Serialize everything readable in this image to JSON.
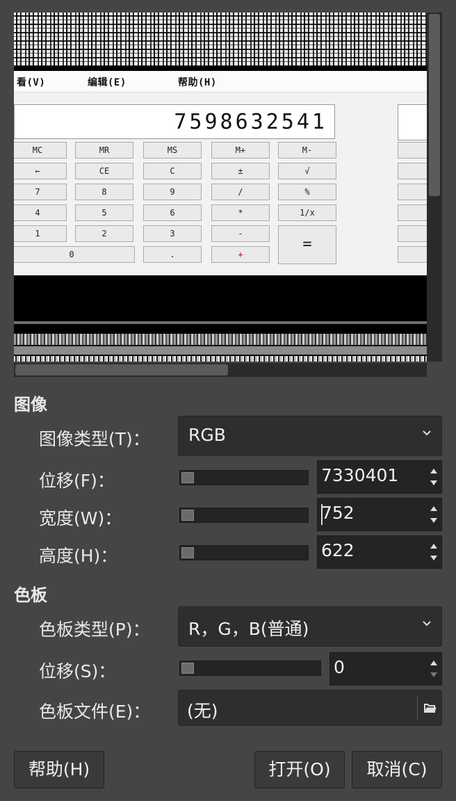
{
  "preview": {
    "menu": [
      "看(V)",
      "编辑(E)",
      "帮助(H)"
    ],
    "display_value": "7598632541",
    "keys": [
      [
        "MC",
        "MR",
        "MS",
        "M+",
        "M-"
      ],
      [
        "←",
        "CE",
        "C",
        "±",
        "√"
      ],
      [
        "7",
        "8",
        "9",
        "/",
        "%"
      ],
      [
        "4",
        "5",
        "6",
        "*",
        "1/x"
      ],
      [
        "1",
        "2",
        "3",
        "-",
        "="
      ],
      [
        "0",
        ".",
        "+"
      ]
    ]
  },
  "image_section": {
    "title": "图像",
    "type_label": "图像类型(T)：",
    "type_value": "RGB",
    "offset_label": "位移(F)：",
    "offset_value": "7330401",
    "width_label": "宽度(W)：",
    "width_value": "752",
    "height_label": "高度(H)：",
    "height_value": "622"
  },
  "palette_section": {
    "title": "色板",
    "type_label": "色板类型(P)：",
    "type_value": "R，G，B(普通)",
    "offset_label": "位移(S)：",
    "offset_value": "0",
    "file_label": "色板文件(E)：",
    "file_value": "(无)"
  },
  "buttons": {
    "help": "帮助(H)",
    "open": "打开(O)",
    "cancel": "取消(C)"
  },
  "icons": {
    "combo_arrow": "chevron-down-icon",
    "spin_up": "spin-up-icon",
    "spin_down": "spin-down-icon",
    "file_open": "open-file-icon"
  }
}
